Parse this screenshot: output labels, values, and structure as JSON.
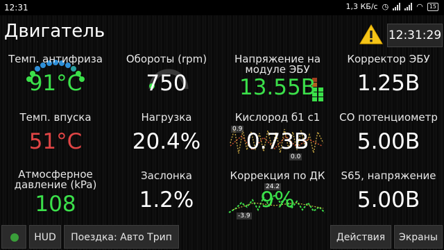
{
  "status_bar": {
    "time": "12:31",
    "network_speed": "1,3 КБ/с",
    "battery": "15"
  },
  "screen": {
    "title": "Двигатель",
    "clock": "12:31:29"
  },
  "gauges": [
    {
      "label": "Темп. антифриза",
      "value": "91°C",
      "color": "#3be04a"
    },
    {
      "label": "Обороты (rpm)",
      "value": "750",
      "color": "#ffffff"
    },
    {
      "label": "Напряжение на модуле ЭБУ",
      "value": "13.55В",
      "color": "#3be04a"
    },
    {
      "label": "Корректор ЭБУ",
      "value": "1.25В",
      "color": "#ffffff"
    },
    {
      "label": "Темп. впуска",
      "value": "51°C",
      "color": "#e04545"
    },
    {
      "label": "Нагрузка",
      "value": "20.4%",
      "color": "#ffffff"
    },
    {
      "label": "Кислород б1 с1",
      "value": "0.73В",
      "color": "#ffffff"
    },
    {
      "label": "CO потенциометр",
      "value": "5.00В",
      "color": "#ffffff"
    },
    {
      "label": "Атмосферное давление (kPa)",
      "value": "108",
      "color": "#3be04a"
    },
    {
      "label": "Заслонка",
      "value": "1.2%",
      "color": "#ffffff"
    },
    {
      "label": "Коррекция по ДК",
      "value": "9%",
      "color": "#3be04a"
    },
    {
      "label": "S65, напряжение",
      "value": "5.00В",
      "color": "#ffffff"
    }
  ],
  "mini_labels": {
    "oxygen_max": "0.9",
    "oxygen_min": "0.0",
    "correction_max": "24.2",
    "correction_min": "-3.9"
  },
  "bottom_bar": {
    "hud": "HUD",
    "trip": "Поездка: Авто Трип",
    "actions": "Действия",
    "screens": "Экраны"
  }
}
